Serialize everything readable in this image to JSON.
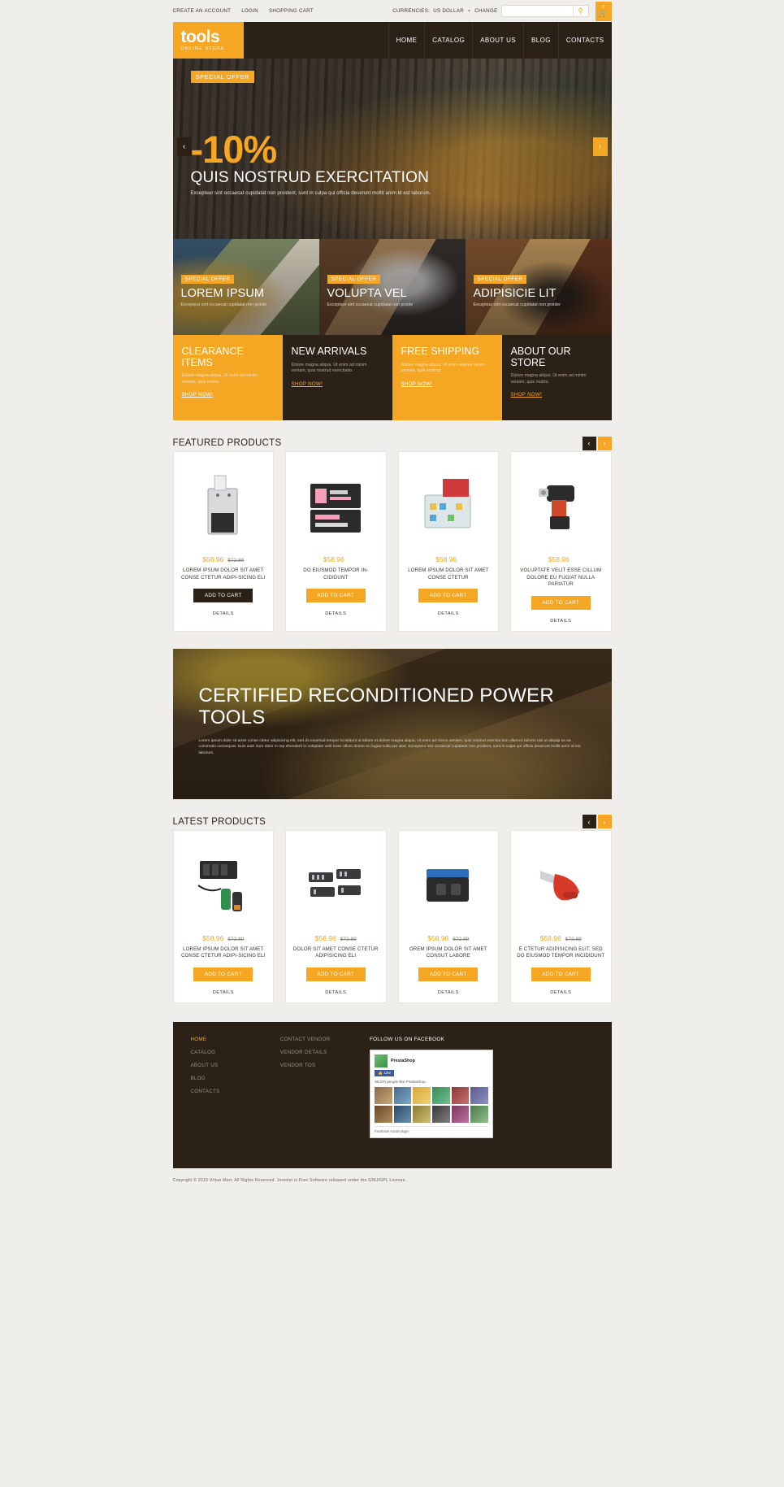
{
  "topbar": {
    "links": [
      "CREATE AN ACCOUNT",
      "LOGIN",
      "SHOPPING CART"
    ],
    "currency_label": "CURRENCIES:",
    "currency_value": "US DOLLAR",
    "currency_change": "CHANGE",
    "search_placeholder": "",
    "search_value": "",
    "cart_count": "0"
  },
  "header": {
    "logo_main": "tools",
    "logo_sub": "ONLINE STORE",
    "nav": [
      "HOME",
      "CATALOG",
      "ABOUT US",
      "BLOG",
      "CONTACTS"
    ]
  },
  "hero": {
    "badge": "SPECIAL OFFER",
    "percent": "-10%",
    "title": "QUIS NOSTRUD EXERCITATION",
    "desc": "Excepteur sint occaecat cupidatat non proident, sunt in culpa qui officia deserunt mollit anim id est laborum.",
    "prev": "‹",
    "next": "›"
  },
  "promos": [
    {
      "badge": "SPECIAL OFFER",
      "title": "LOREM IPSUM",
      "desc": "Excepteur sint occaecat cupidatat non proide"
    },
    {
      "badge": "SPECIAL OFFER",
      "title": "VOLUPTA VEL",
      "desc": "Excepteur sint occaecat cupidatat non proide"
    },
    {
      "badge": "SPECIAL OFFER",
      "title": "ADIPISICIE LIT",
      "desc": "Excepteur sint occaecat cupidatat non proider"
    }
  ],
  "infos": [
    {
      "title": "CLEARANCE ITEMS",
      "desc": "Dolore magna aliqua. Ut enim ad minim veniam, quis nostru.",
      "link": "SHOP NOW!",
      "style": "orange"
    },
    {
      "title": "NEW ARRIVALS",
      "desc": "Dolore magna aliqua. Ut enim ad minim veniam, quis nostrud exercitatio.",
      "link": "SHOP NOW!",
      "style": "dark"
    },
    {
      "title": "FREE SHIPPING",
      "desc": "Dolore magna aliqua. Ut enim aderes minim veniam, quis nostrud.",
      "link": "SHOP NOW!",
      "style": "orange"
    },
    {
      "title": "ABOUT OUR STORE",
      "desc": "Dolore magna aliqua. Ut enim ad minim veniam, quis nostru.",
      "link": "SHOP NOW!",
      "style": "dark"
    }
  ],
  "featured": {
    "title": "FEATURED PRODUCTS",
    "prev": "‹",
    "next": "›",
    "products": [
      {
        "price": "$58.96",
        "old_price": "$72.89",
        "name": "LOREM IPSUM DOLOR SIT AMET CONSE CTETUR ADIPI-SICING ELI",
        "cart": "ADD TO CART",
        "details": "DETAILS",
        "cart_style": "dark"
      },
      {
        "price": "$58.96",
        "old_price": "",
        "name": "DO EIUSMOD TEMPOR IN-CIDIDUNT",
        "cart": "ADD TO CART",
        "details": "DETAILS",
        "cart_style": "orange"
      },
      {
        "price": "$58.96",
        "old_price": "",
        "name": "LOREM IPSUM DOLOR SIT AMET CONSE CTETUR",
        "cart": "ADD TO CART",
        "details": "DETAILS",
        "cart_style": "orange"
      },
      {
        "price": "$58.96",
        "old_price": "",
        "name": "VOLUPTATE VELIT ESSE CILLUM DOLORE EU FUGIAT NULLA PARIATUR",
        "cart": "ADD TO CART",
        "details": "DETAILS",
        "cart_style": "orange"
      }
    ]
  },
  "wide_banner": {
    "title": "CERTIFIED RECONDITIONED POWER TOOLS",
    "desc": "Lorem ipsum dolor sit amet conse ctetur adipisicing elit, sed do eiusmod tempor incididunt ut labore et dolore magna aliqua. Ut enim ad minim veniam, quis nostrud exercita tion ullamco laboris nisi ut aliquip ex ea commodo consequat. Duis aute irure dolor in rep ehenderit in voluptate velit esse cillum dolore eu fugiat nulla par iatur. Excepteur sint occaecat cupidatat non proident, sunt in culpa qui officia deserunt mollit anim id est laborum."
  },
  "latest": {
    "title": "LATEST PRODUCTS",
    "prev": "‹",
    "next": "›",
    "products": [
      {
        "price": "$58.96",
        "old_price": "$72.89",
        "name": "LOREM IPSUM DOLOR SIT AMET CONSE CTETUR ADIPI-SICING ELI",
        "cart": "ADD TO CART",
        "details": "DETAILS",
        "cart_style": "orange"
      },
      {
        "price": "$58.96",
        "old_price": "$72.89",
        "name": "DOLOR SIT AMET CONSE CTETUR ADIPISICING ELI",
        "cart": "ADD TO CART",
        "details": "DETAILS",
        "cart_style": "orange"
      },
      {
        "price": "$58.96",
        "old_price": "$72.89",
        "name": "OREM IPSUM DOLOR SIT AMET CONSUT LABORE",
        "cart": "ADD TO CART",
        "details": "DETAILS",
        "cart_style": "orange"
      },
      {
        "price": "$58.96",
        "old_price": "$72.89",
        "name": "E CTETUR ADIPISICING ELIT, SED DO EIUSMOD TEMPOR INCIDIDUNT",
        "cart": "ADD TO CART",
        "details": "DETAILS",
        "cart_style": "orange"
      }
    ]
  },
  "footer": {
    "col1": {
      "heading": "",
      "links": [
        "HOME",
        "CATALOG",
        "ABOUT US",
        "BLOG",
        "CONTACTS"
      ]
    },
    "col2": {
      "heading": "",
      "links": [
        "CONTACT VENDOR",
        "VENDOR DETAILS",
        "VENDOR TOS"
      ]
    },
    "col3": {
      "heading": "FOLLOW US ON FACEBOOK",
      "fb_page": "PrestaShop",
      "fb_like": "Like",
      "fb_count": "38,670 people like PrestaShop.",
      "fb_footer": "Facebook social plugin"
    },
    "copyright": "Copyright © 2015 Virtue Mart.  All Rights Reserved. Joomla! is Free Software released under the GNU/GPL License."
  }
}
